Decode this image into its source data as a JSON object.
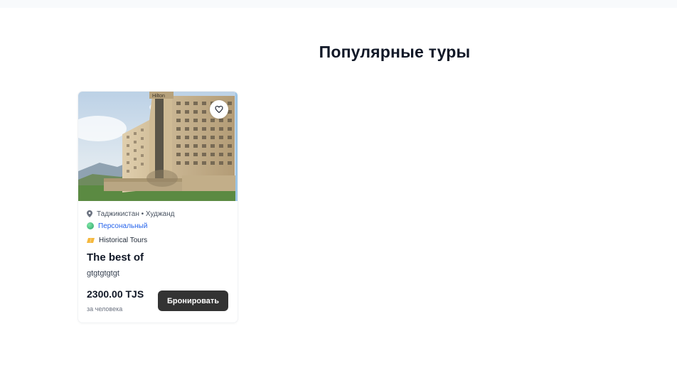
{
  "section": {
    "title": "Популярные туры"
  },
  "tours": [
    {
      "location": "Таджикистан • Худжанд",
      "tour_type": "Персональный",
      "category": "Historical Tours",
      "title": "The best of",
      "description": "gtgtgtgtgt",
      "price": "2300.00 TJS",
      "per_person": "за человека",
      "book_label": "Бронировать",
      "hotel_sign": "Hilton"
    }
  ],
  "icons": {
    "favorite": "heart-icon",
    "location": "location-pin-icon",
    "type": "globe-icon",
    "category": "ticket-icon"
  },
  "colors": {
    "accent_link": "#2563eb",
    "button": "#333333",
    "title": "#111827"
  }
}
